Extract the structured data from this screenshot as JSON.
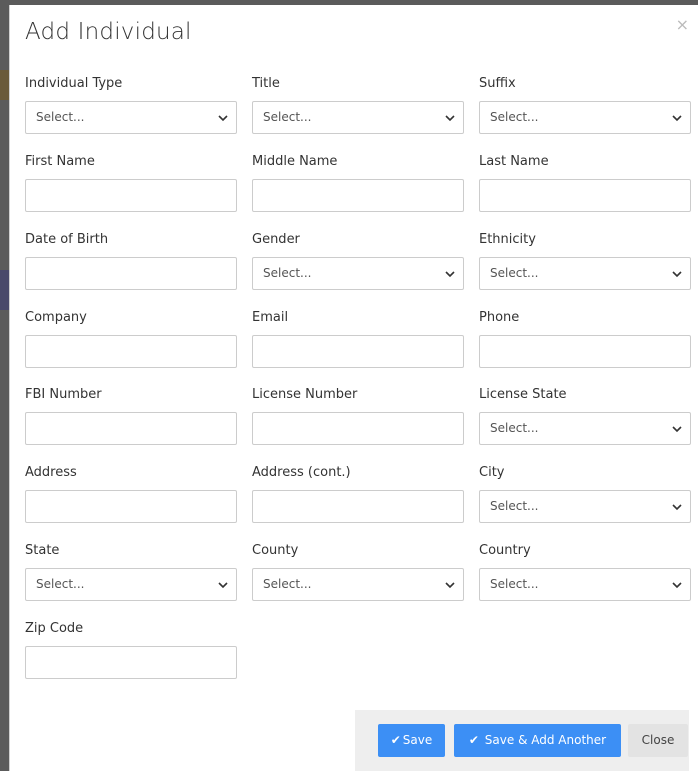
{
  "modal": {
    "title": "Add Individual",
    "close_glyph": "×"
  },
  "fields": {
    "individual_type": {
      "label": "Individual Type",
      "value": "Select..."
    },
    "title": {
      "label": "Title",
      "value": "Select..."
    },
    "suffix": {
      "label": "Suffix",
      "value": "Select..."
    },
    "first_name": {
      "label": "First Name",
      "value": ""
    },
    "middle_name": {
      "label": "Middle Name",
      "value": ""
    },
    "last_name": {
      "label": "Last Name",
      "value": ""
    },
    "date_of_birth": {
      "label": "Date of Birth",
      "value": ""
    },
    "gender": {
      "label": "Gender",
      "value": "Select..."
    },
    "ethnicity": {
      "label": "Ethnicity",
      "value": "Select..."
    },
    "company": {
      "label": "Company",
      "value": ""
    },
    "email": {
      "label": "Email",
      "value": ""
    },
    "phone": {
      "label": "Phone",
      "value": ""
    },
    "fbi_number": {
      "label": "FBI Number",
      "value": ""
    },
    "license_number": {
      "label": "License Number",
      "value": ""
    },
    "license_state": {
      "label": "License State",
      "value": "Select..."
    },
    "address": {
      "label": "Address",
      "value": ""
    },
    "address_cont": {
      "label": "Address (cont.)",
      "value": ""
    },
    "city": {
      "label": "City",
      "value": "Select..."
    },
    "state": {
      "label": "State",
      "value": "Select..."
    },
    "county": {
      "label": "County",
      "value": "Select..."
    },
    "country": {
      "label": "Country",
      "value": "Select..."
    },
    "zip_code": {
      "label": "Zip Code",
      "value": ""
    }
  },
  "footer": {
    "save_label": "Save",
    "save_add_label": "Save & Add Another",
    "close_label": "Close",
    "check_glyph": "✔"
  },
  "colors": {
    "primary": "#3c8ff5",
    "footer_bg": "#eeeeee",
    "border": "#cccccc"
  }
}
